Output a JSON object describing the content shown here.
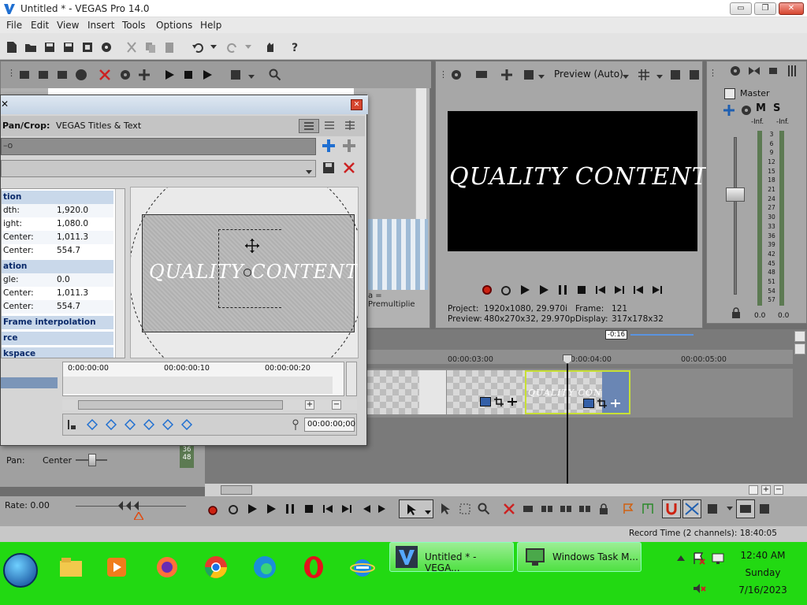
{
  "window": {
    "title": "Untitled * - VEGAS Pro 14.0",
    "minimize_label": "▭",
    "maximize_label": "❐",
    "close_label": "✕"
  },
  "menu": {
    "items": [
      "File",
      "Edit",
      "View",
      "Insert",
      "Tools",
      "Options",
      "Help"
    ]
  },
  "mixer": {
    "master_label": "Master",
    "mute_label": "M",
    "solo_label": "S",
    "left_inf": "-Inf.",
    "right_inf": "-Inf.",
    "scale": [
      "3",
      "6",
      "9",
      "12",
      "15",
      "18",
      "21",
      "24",
      "27",
      "30",
      "33",
      "36",
      "39",
      "42",
      "45",
      "48",
      "51",
      "54",
      "57"
    ],
    "left_value": "0.0",
    "right_value": "0.0"
  },
  "preview": {
    "mode_label": "Preview (Auto)",
    "overlay_text": "QUALITY CONTENT",
    "project_label": "Project:",
    "project_value": "1920x1080, 29.970i",
    "frame_label": "Frame:",
    "frame_value": "121",
    "preview_label": "Preview:",
    "preview_value": "480x270x32, 29.970p",
    "display_label": "Display:",
    "display_value": "317x178x32"
  },
  "pancrop": {
    "title_prefix": "Pan/Crop:",
    "title_value": "VEGAS Titles & Text",
    "canvas_text": "QUALITY CONTENT",
    "sections": {
      "position": "tion",
      "rotation": "ation",
      "keyframe_interpolation": "Frame interpolation",
      "source": "rce",
      "workspace": "kspace"
    },
    "rows": [
      {
        "label": "dth:",
        "value": "1,920.0"
      },
      {
        "label": "ight:",
        "value": "1,080.0"
      },
      {
        "label": "Center:",
        "value": "1,011.3"
      },
      {
        "label": "Center:",
        "value": "554.7"
      },
      {
        "label": "gle:",
        "value": "0.0"
      },
      {
        "label": "Center:",
        "value": "1,011.3"
      },
      {
        "label": "Center:",
        "value": "554.7"
      }
    ],
    "ruler": [
      "0:00:00:00",
      "00:00:00:10",
      "00:00:00:20"
    ],
    "timecode": "00:00:00;00",
    "premultiplied_text": "a = Premultiplie"
  },
  "timeline": {
    "ruler": [
      "00:00:03:00",
      "00:00:04:00",
      "00:00:05:00"
    ],
    "offset_badge": "-0:16",
    "clip_text": "QUALITY CONTENT",
    "pan_label": "Pan:",
    "pan_value": "Center",
    "level_numbers": [
      "36",
      "48"
    ],
    "rate_label": "Rate: 0.00",
    "record_time": "Record Time (2 channels): 18:40:05"
  },
  "taskbar": {
    "tasks": [
      {
        "label": "Untitled * - VEGA..."
      },
      {
        "label": "Windows Task M..."
      }
    ],
    "clock_time": "12:40 AM",
    "clock_day": "Sunday",
    "clock_date": "7/16/2023"
  }
}
